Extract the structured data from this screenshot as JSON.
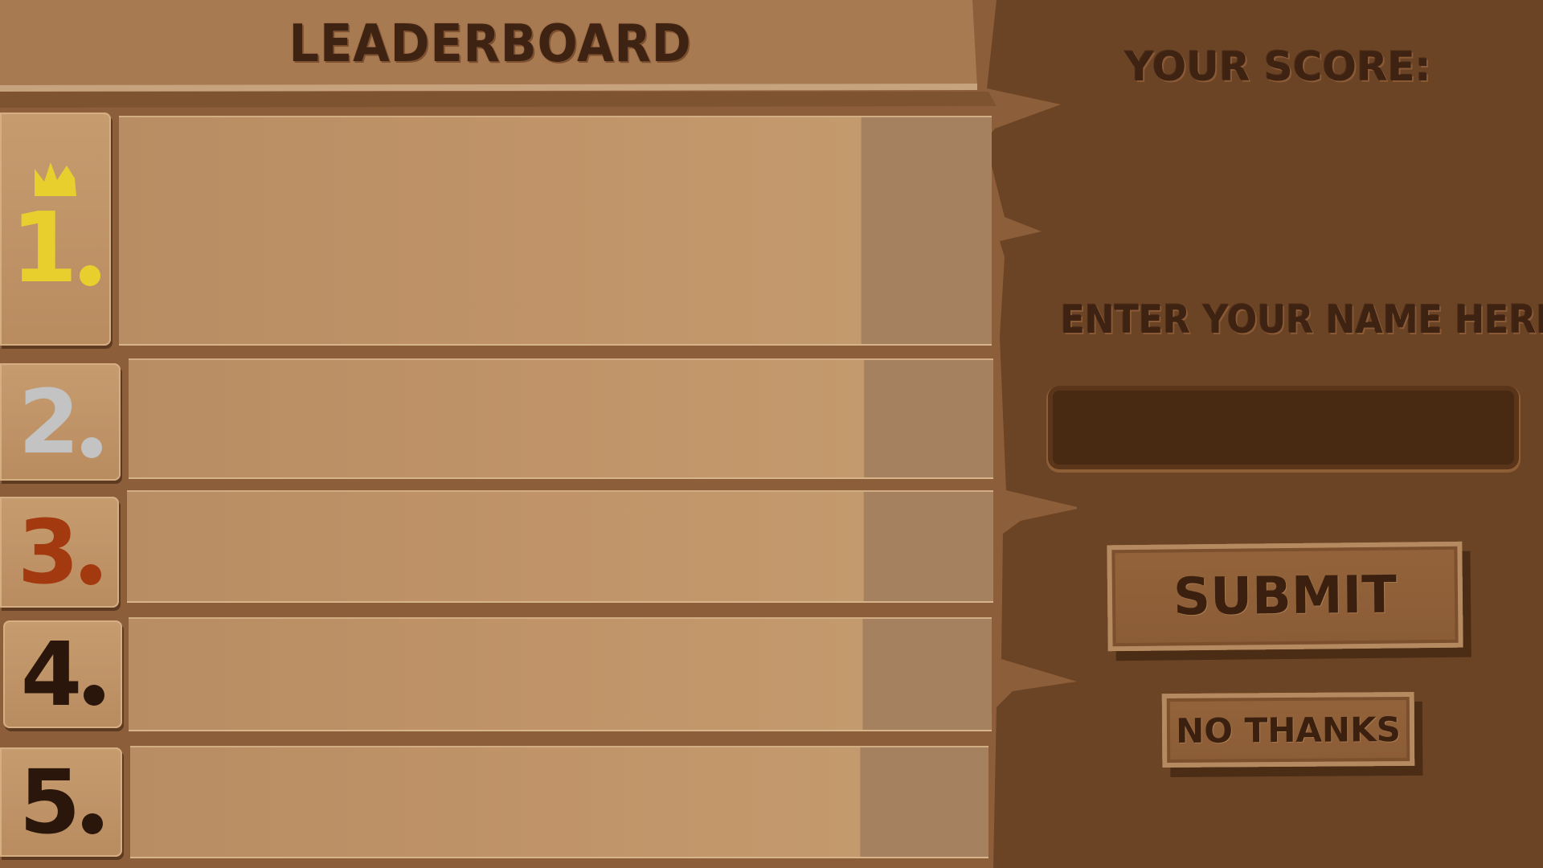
{
  "leaderboard": {
    "title": "LEADERBOARD",
    "rows": [
      {
        "rank": "1",
        "name": "",
        "score": ""
      },
      {
        "rank": "2",
        "name": "",
        "score": ""
      },
      {
        "rank": "3",
        "name": "",
        "score": ""
      },
      {
        "rank": "4",
        "name": "",
        "score": ""
      },
      {
        "rank": "5",
        "name": "",
        "score": ""
      }
    ],
    "rank_colors": {
      "first": "#e8cf2e",
      "second": "#c3c3c3",
      "third": "#a3390f",
      "other": "#2b160b"
    }
  },
  "score_panel": {
    "your_score_label": "YOUR SCORE:",
    "score_value": "",
    "enter_name_label": "ENTER YOUR NAME HERE!",
    "name_input": {
      "value": "",
      "placeholder": ""
    },
    "submit_label": "SUBMIT",
    "no_thanks_label": "NO THANKS"
  },
  "colors": {
    "dark_wood": "#6b4325",
    "light_wood": "#c09468",
    "text_dark": "#3e2212"
  },
  "icons": {
    "crown": "crown-icon"
  }
}
